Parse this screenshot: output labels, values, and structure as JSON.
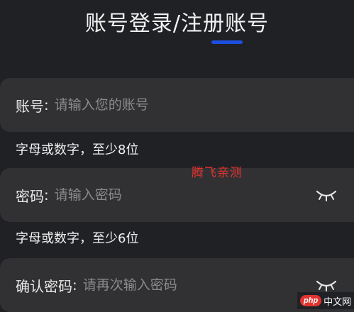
{
  "header": {
    "title": "账号登录/注册账号",
    "accent_color": "#1d4fe0"
  },
  "form": {
    "account": {
      "label": "账号",
      "placeholder": "请输入您的账号",
      "hint": "字母或数字，至少8位"
    },
    "password": {
      "label": "密码",
      "placeholder": "请输入密码",
      "hint": "字母或数字，至少6位",
      "toggle_icon": "eye-closed-icon"
    },
    "confirm_password": {
      "label": "确认密码",
      "placeholder": "请再次输入密码",
      "toggle_icon": "eye-closed-icon"
    },
    "colon": ":"
  },
  "watermark": {
    "text": "腾飞亲测",
    "color": "#e0332f"
  },
  "badge": {
    "logo_text": "php",
    "site_text": "中文网"
  }
}
